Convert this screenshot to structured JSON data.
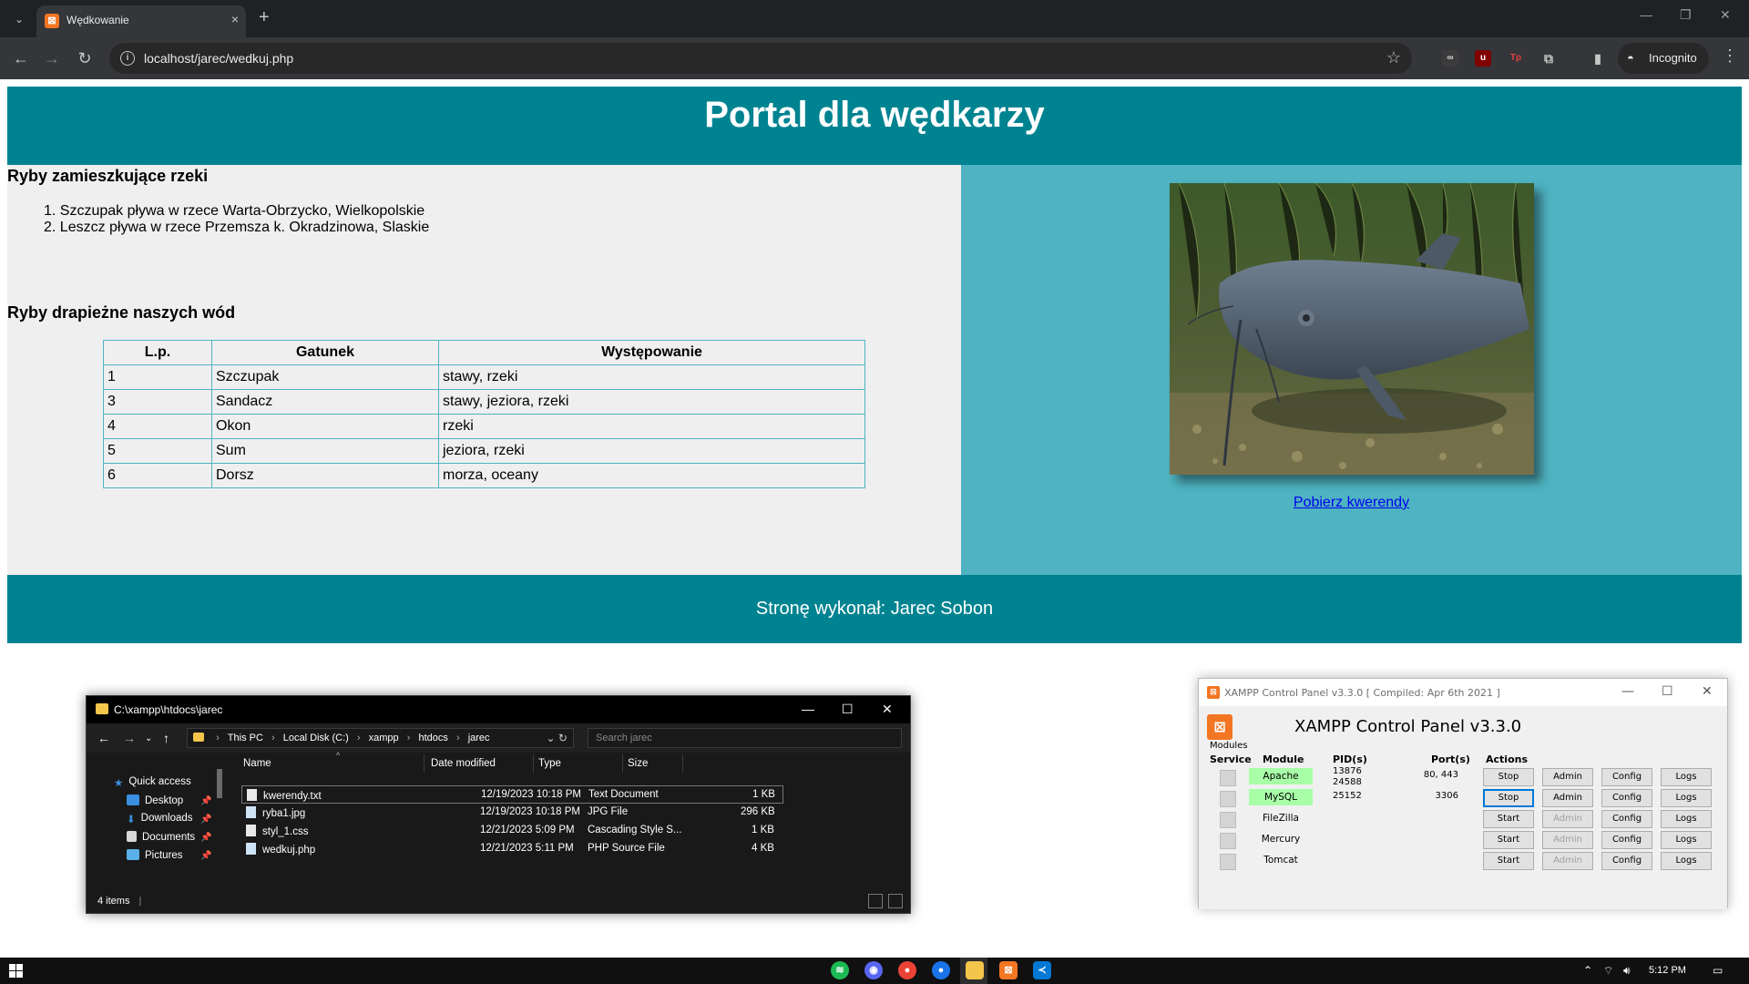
{
  "browser": {
    "tab_title": "Wędkowanie",
    "tab_close": "×",
    "new_tab": "+",
    "url": "localhost/jarec/wedkuj.php",
    "incognito_label": "Incognito",
    "ext_icons": [
      "glasses-icon",
      "ublock-icon",
      "translate-icon",
      "puzzle-icon",
      "sidepanel-icon"
    ]
  },
  "page": {
    "title": "Portal dla wędkarzy",
    "section1_heading": "Ryby zamieszkujące rzeki",
    "rivers": [
      "1. Szczupak pływa w rzece Warta-Obrzycko, Wielkopolskie",
      "2. Leszcz pływa w rzece Przemsza k. Okradzinowa, Slaskie"
    ],
    "section2_heading": "Ryby drapieżne naszych wód",
    "table": {
      "headers": [
        "L.p.",
        "Gatunek",
        "Występowanie"
      ],
      "rows": [
        [
          "1",
          "Szczupak",
          "stawy, rzeki"
        ],
        [
          "3",
          "Sandacz",
          "stawy, jeziora, rzeki"
        ],
        [
          "4",
          "Okon",
          "rzeki"
        ],
        [
          "5",
          "Sum",
          "jeziora, rzeki"
        ],
        [
          "6",
          "Dorsz",
          "morza, oceany"
        ]
      ]
    },
    "download_link": "Pobierz kwerendy",
    "footer": "Stronę wykonał: Jarec Sobon"
  },
  "explorer": {
    "title": "C:\\xampp\\htdocs\\jarec",
    "breadcrumb": [
      "This PC",
      "Local Disk (C:)",
      "xampp",
      "htdocs",
      "jarec"
    ],
    "search_placeholder": "Search jarec",
    "sidebar": [
      "Quick access",
      "Desktop",
      "Downloads",
      "Documents",
      "Pictures"
    ],
    "columns": [
      "Name",
      "Date modified",
      "Type",
      "Size"
    ],
    "files": [
      {
        "name": "kwerendy.txt",
        "date": "12/19/2023 10:18 PM",
        "type": "Text Document",
        "size": "1 KB"
      },
      {
        "name": "ryba1.jpg",
        "date": "12/19/2023 10:18 PM",
        "type": "JPG File",
        "size": "296 KB"
      },
      {
        "name": "styl_1.css",
        "date": "12/21/2023 5:09 PM",
        "type": "Cascading Style S...",
        "size": "1 KB"
      },
      {
        "name": "wedkuj.php",
        "date": "12/21/2023 5:11 PM",
        "type": "PHP Source File",
        "size": "4 KB"
      }
    ],
    "status": "4 items"
  },
  "xampp": {
    "title": "XAMPP Control Panel v3.3.0   [ Compiled: Apr 6th 2021 ]",
    "heading": "XAMPP Control Panel v3.3.0",
    "modules_label": "Modules",
    "headers": {
      "service": "Service",
      "module": "Module",
      "pid": "PID(s)",
      "port": "Port(s)",
      "actions": "Actions"
    },
    "rows": [
      {
        "module": "Apache",
        "pid1": "13876",
        "pid2": "24588",
        "port": "80, 443",
        "action": "Stop",
        "admin": "Admin",
        "config": "Config",
        "logs": "Logs",
        "running": true
      },
      {
        "module": "MySQL",
        "pid1": "25152",
        "pid2": "",
        "port": "3306",
        "action": "Stop",
        "admin": "Admin",
        "config": "Config",
        "logs": "Logs",
        "running": true
      },
      {
        "module": "FileZilla",
        "pid1": "",
        "pid2": "",
        "port": "",
        "action": "Start",
        "admin": "Admin",
        "config": "Config",
        "logs": "Logs",
        "running": false
      },
      {
        "module": "Mercury",
        "pid1": "",
        "pid2": "",
        "port": "",
        "action": "Start",
        "admin": "Admin",
        "config": "Config",
        "logs": "Logs",
        "running": false
      },
      {
        "module": "Tomcat",
        "pid1": "",
        "pid2": "",
        "port": "",
        "action": "Start",
        "admin": "Admin",
        "config": "Config",
        "logs": "Logs",
        "running": false
      }
    ]
  },
  "taskbar": {
    "clock": "5:12 PM",
    "apps": [
      "spotify-icon",
      "discord-icon",
      "chrome-icon",
      "chrome-dev-icon",
      "file-explorer-icon",
      "xampp-icon",
      "vscode-icon"
    ]
  },
  "colors": {
    "banner": "#008391",
    "right_panel": "#4fb3c1",
    "left_panel": "#efefef",
    "link": "#0000ee"
  }
}
